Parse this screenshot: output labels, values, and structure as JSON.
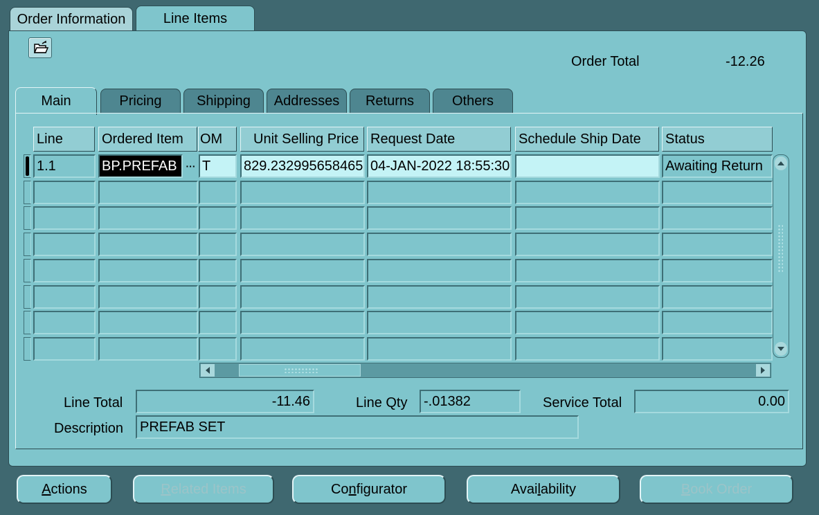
{
  "top_tabs": [
    {
      "label": "Order Information",
      "active": false
    },
    {
      "label": "Line Items",
      "active": true
    }
  ],
  "order_total": {
    "label": "Order Total",
    "value": "-12.26"
  },
  "sub_tabs": [
    {
      "label": "Main",
      "active": true
    },
    {
      "label": "Pricing",
      "active": false
    },
    {
      "label": "Shipping",
      "active": false
    },
    {
      "label": "Addresses",
      "active": false
    },
    {
      "label": "Returns",
      "active": false
    },
    {
      "label": "Others",
      "active": false
    }
  ],
  "grid": {
    "columns": [
      "Line",
      "Ordered Item",
      "OM",
      "Unit Selling Price",
      "Request Date",
      "Schedule Ship Date",
      "Status"
    ],
    "rows": [
      {
        "line": "1.1",
        "ordered_item": "BP.PREFAB",
        "lov_button": "···",
        "uom": "T",
        "unit_selling_price": "829.232995658465",
        "request_date": "04-JAN-2022 18:55:30",
        "schedule_ship_date": "",
        "status": "Awaiting Return"
      }
    ]
  },
  "summary": {
    "line_total_label": "Line Total",
    "line_total": "-11.46",
    "line_qty_label": "Line Qty",
    "line_qty": "-.01382",
    "service_total_label": "Service Total",
    "service_total": "0.00",
    "description_label": "Description",
    "description": "PREFAB SET"
  },
  "buttons": {
    "actions": {
      "mnemonic": "A",
      "rest": "ctions"
    },
    "related_items": {
      "mnemonic": "R",
      "rest": "elated Items"
    },
    "configurator": {
      "pre": "Co",
      "mnemonic": "n",
      "rest": "figurator"
    },
    "availability": {
      "pre": "Avai",
      "mnemonic": "l",
      "rest": "ability"
    },
    "book_order": {
      "mnemonic": "B",
      "rest": "ook Order"
    }
  },
  "colors": {
    "background": "#3f6870",
    "panel": "#7fc5cc",
    "inactive_tab": "#4e8690",
    "selected_cell": "#000000",
    "editable_cell": "#c4f3f6"
  },
  "icons": {
    "toolbar": "open-folder-icon"
  }
}
